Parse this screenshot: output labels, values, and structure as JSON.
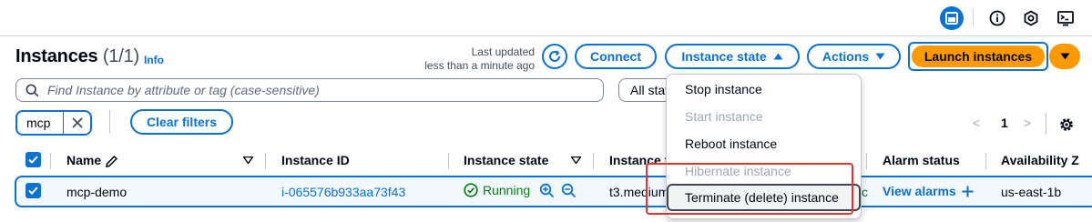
{
  "colors": {
    "accent": "#0972d3",
    "launch": "#ff9900",
    "running": "#037f0c",
    "annotation": "#e0342f"
  },
  "topbar": {
    "icons": [
      "panel-icon",
      "info-circle-icon",
      "settings-hex-icon",
      "cloudshell-icon"
    ]
  },
  "header": {
    "title": "Instances",
    "count": "(1/1)",
    "info": "Info",
    "last_updated_line1": "Last updated",
    "last_updated_line2": "less than a minute ago",
    "connect": "Connect",
    "instance_state": "Instance state",
    "actions": "Actions",
    "launch": "Launch instances"
  },
  "search": {
    "placeholder": "Find Instance by attribute or tag (case-sensitive)",
    "state_filter": "All states"
  },
  "filters": {
    "token": "mcp",
    "clear": "Clear filters"
  },
  "pagination": {
    "prev": "<",
    "page": "1",
    "next": ">"
  },
  "table": {
    "columns": [
      "Name",
      "Instance ID",
      "Instance state",
      "Instance type",
      "Alarm status",
      "Availability Z"
    ],
    "row": {
      "name": "mcp-demo",
      "instance_id": "i-065576b933aa73f43",
      "state": "Running",
      "type": "t3.medium",
      "status_tail": "c",
      "alarm": "View alarms",
      "az": "us-east-1b"
    }
  },
  "menu": {
    "items": [
      {
        "label": "Stop instance",
        "disabled": false
      },
      {
        "label": "Start instance",
        "disabled": true
      },
      {
        "label": "Reboot instance",
        "disabled": false
      },
      {
        "label": "Hibernate instance",
        "disabled": true
      },
      {
        "label": "Terminate (delete) instance",
        "disabled": false
      }
    ]
  }
}
